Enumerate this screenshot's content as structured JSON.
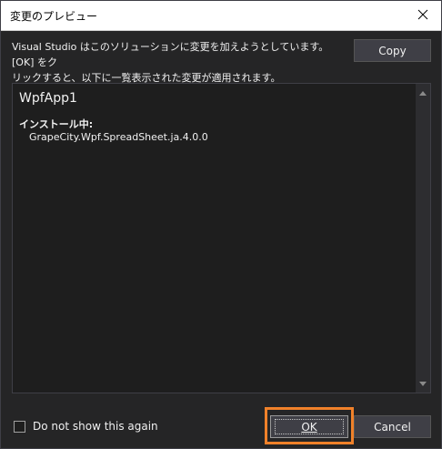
{
  "window": {
    "title": "変更のプレビュー"
  },
  "description": {
    "line1": "Visual Studio はこのソリューションに変更を加えようとしています。[OK] をク",
    "line2": "リックすると、以下に一覧表示された変更が適用されます。"
  },
  "buttons": {
    "copy_label": "Copy",
    "ok_label": "OK",
    "cancel_label": "Cancel"
  },
  "preview": {
    "project_name": "WpfApp1",
    "section_label": "インストール中:",
    "package": "GrapeCity.Wpf.SpreadSheet.ja.4.0.0"
  },
  "options": {
    "do_not_show_label": "Do not show this again",
    "do_not_show_checked": false
  },
  "colors": {
    "highlight": "#f0812a",
    "background": "#252526"
  }
}
